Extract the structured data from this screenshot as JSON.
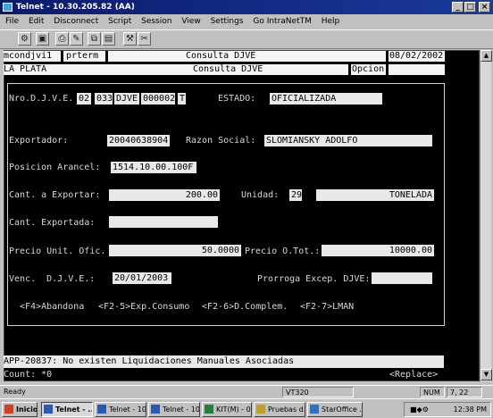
{
  "window": {
    "title": "Telnet - 10.30.205.82 (AA)",
    "min_label": "_",
    "max_label": "□",
    "close_label": "×"
  },
  "menu": [
    "File",
    "Edit",
    "Disconnect",
    "Script",
    "Session",
    "View",
    "Settings",
    "Go IntraNetTM",
    "Help"
  ],
  "terminal": {
    "header1": {
      "user": "mcondjvi1",
      "program": "prterm",
      "title": "Consulta DJVE",
      "date": "08/02/2002"
    },
    "header2": {
      "location": "LA PLATA",
      "title": "Consulta DJVE",
      "option_label": "Opcion"
    },
    "nro_label": "Nro.D.J.V.E.",
    "nro_parts": [
      "02",
      "033",
      "DJVE",
      "000002",
      "T"
    ],
    "estado_label": "ESTADO:",
    "estado_value": "OFICIALIZADA",
    "exportador_label": "Exportador:",
    "exportador_value": "20040638904",
    "razon_label": "Razon Social:",
    "razon_value": "SLOMIANSKY ADOLFO",
    "posicion_label": "Posicion Arancel:",
    "posicion_value": "1514.10.00.100F",
    "cant_exportar_label": "Cant. a Exportar:",
    "cant_exportar_value": "200.00",
    "unidad_label": "Unidad:",
    "unidad_code": "29",
    "unidad_value": "TONELADA",
    "cant_exportada_label": "Cant. Exportada:",
    "cant_exportada_value": "",
    "precio_unit_label": "Precio Unit. Ofic.",
    "precio_unit_value": "50.0000",
    "precio_tot_label": "Precio O.Tot.:",
    "precio_tot_value": "10000.00",
    "venc_label": "Venc.  D.J.V.E.:",
    "venc_value": "20/01/2003",
    "prorroga_label": "Prorroga Excep. DJVE:",
    "prorroga_value": "",
    "fkeys": [
      "<F4>Abandona",
      "<F2-5>Exp.Consumo",
      "<F2-6>D.Complem.",
      "<F2-7>LMAN"
    ],
    "message": "APP-20837: No existen Liquidaciones Manuales Asociadas",
    "count": "Count: *0",
    "replace": "<Replace>"
  },
  "statusbar": {
    "ready": "Ready",
    "terminal_type": "VT320",
    "num": "NUM",
    "position": "7, 22"
  },
  "taskbar": {
    "start": "Inicio",
    "tasks": [
      "Telnet - ...",
      "Telnet - 10...",
      "Telnet - 10...",
      "KIT(M) - 0...",
      "Pruebas d...",
      "StarOffice ..."
    ],
    "clock": "12:38 PM"
  },
  "colors": {
    "title_bar": "#0a1a6b",
    "terminal_bg": "#000000",
    "field_bg": "#e8e8e8",
    "label_fg": "#d8d8d8"
  }
}
